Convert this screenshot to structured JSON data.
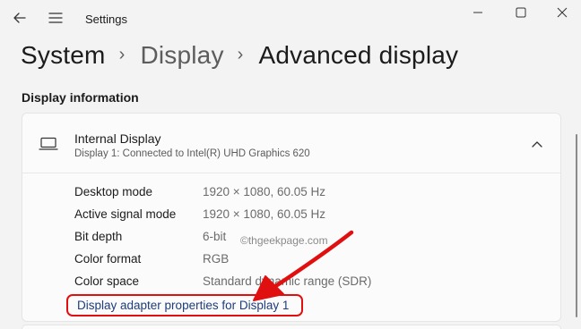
{
  "window": {
    "title": "Settings"
  },
  "breadcrumb": {
    "items": [
      "System",
      "Display",
      "Advanced display"
    ],
    "separator": "›"
  },
  "section": {
    "title": "Display information"
  },
  "display_card": {
    "title": "Internal Display",
    "subtitle": "Display 1: Connected to Intel(R) UHD Graphics 620",
    "properties": [
      {
        "label": "Desktop mode",
        "value": "1920 × 1080, 60.05 Hz"
      },
      {
        "label": "Active signal mode",
        "value": "1920 × 1080, 60.05 Hz"
      },
      {
        "label": "Bit depth",
        "value": "6-bit"
      },
      {
        "label": "Color format",
        "value": "RGB"
      },
      {
        "label": "Color space",
        "value": "Standard dynamic range (SDR)"
      }
    ],
    "adapter_link": "Display adapter properties for Display 1"
  },
  "watermark": "©thgeekpage.com",
  "colors": {
    "highlight": "#e01010",
    "link": "#1f3d7a"
  }
}
